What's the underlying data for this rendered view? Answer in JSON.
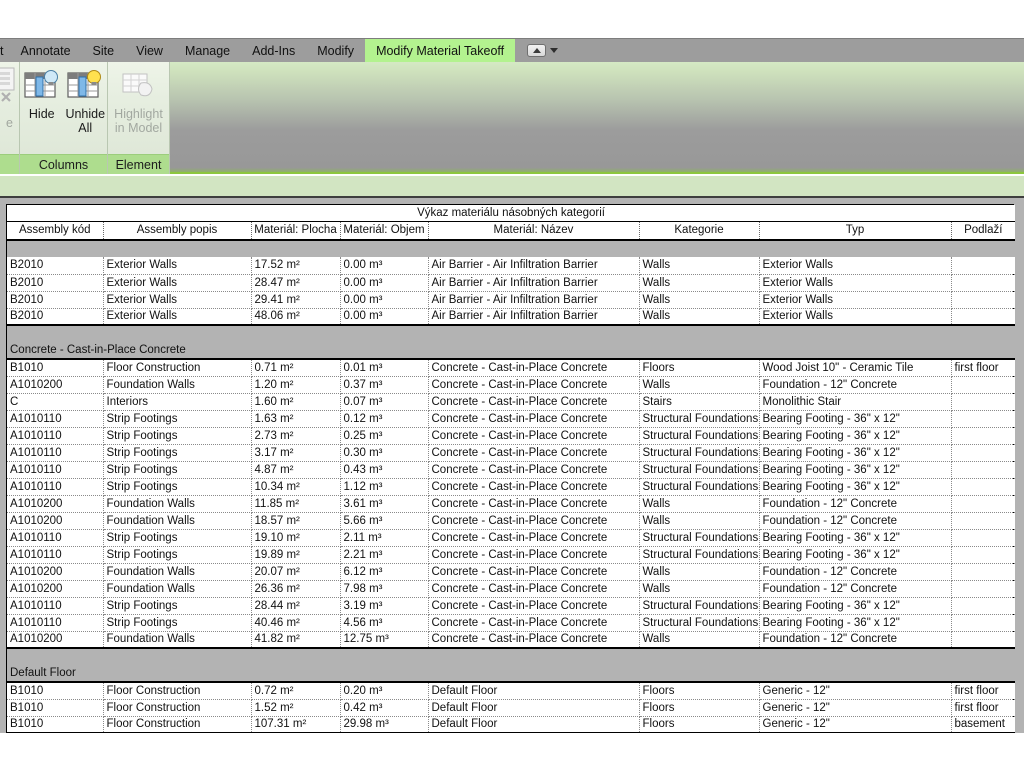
{
  "app": {
    "ribbon_tabs": [
      {
        "label": "t",
        "partial": true,
        "active": false
      },
      {
        "label": "Annotate",
        "partial": false,
        "active": false
      },
      {
        "label": "Site",
        "partial": false,
        "active": false
      },
      {
        "label": "View",
        "partial": false,
        "active": false
      },
      {
        "label": "Manage",
        "partial": false,
        "active": false
      },
      {
        "label": "Add-Ins",
        "partial": false,
        "active": false
      },
      {
        "label": "Modify",
        "partial": false,
        "active": false
      },
      {
        "label": "Modify Material Takeoff",
        "partial": false,
        "active": true
      }
    ],
    "accent_green": "#8cc63e",
    "active_tab_bg": "#b3f28f",
    "tabstrip_bg": "#9d9d9d"
  },
  "ribbon": {
    "panels": [
      {
        "title": "",
        "clipped": true,
        "buttons": [
          {
            "label": "e",
            "disabled": true,
            "icon": "paste-icon"
          }
        ]
      },
      {
        "title": "Columns",
        "clipped": false,
        "buttons": [
          {
            "label": "Hide",
            "disabled": false,
            "icon": "hide-columns-icon"
          },
          {
            "label": "Unhide All",
            "disabled": false,
            "icon": "unhide-all-columns-icon"
          }
        ]
      },
      {
        "title": "Element",
        "clipped": false,
        "buttons": [
          {
            "label": "Highlight in Model",
            "disabled": true,
            "icon": "highlight-in-model-icon"
          }
        ]
      }
    ]
  },
  "schedule": {
    "title": "Výkaz materiálu násobných kategorií",
    "columns": [
      "Assembly kód",
      "Assembly popis",
      "Materiál: Plocha",
      "Materiál: Objem",
      "Materiál: Název",
      "Kategorie",
      "Typ",
      "Podlaží"
    ],
    "groups": [
      {
        "header": null,
        "rows": [
          [
            "B2010",
            "Exterior Walls",
            "17.52 m²",
            "0.00 m³",
            "Air Barrier - Air Infiltration Barrier",
            "Walls",
            "Exterior Walls",
            ""
          ],
          [
            "B2010",
            "Exterior Walls",
            "28.47 m²",
            "0.00 m³",
            "Air Barrier - Air Infiltration Barrier",
            "Walls",
            "Exterior Walls",
            ""
          ],
          [
            "B2010",
            "Exterior Walls",
            "29.41 m²",
            "0.00 m³",
            "Air Barrier - Air Infiltration Barrier",
            "Walls",
            "Exterior Walls",
            ""
          ],
          [
            "B2010",
            "Exterior Walls",
            "48.06 m²",
            "0.00 m³",
            "Air Barrier - Air Infiltration Barrier",
            "Walls",
            "Exterior Walls",
            ""
          ]
        ]
      },
      {
        "header": "Concrete - Cast-in-Place Concrete",
        "rows": [
          [
            "B1010",
            "Floor Construction",
            "0.71 m²",
            "0.01 m³",
            "Concrete - Cast-in-Place Concrete",
            "Floors",
            "Wood Joist 10\" - Ceramic Tile",
            "first floor"
          ],
          [
            "A1010200",
            "Foundation Walls",
            "1.20 m²",
            "0.37 m³",
            "Concrete - Cast-in-Place Concrete",
            "Walls",
            "Foundation - 12\" Concrete",
            ""
          ],
          [
            "C",
            "Interiors",
            "1.60 m²",
            "0.07 m³",
            "Concrete - Cast-in-Place Concrete",
            "Stairs",
            "Monolithic Stair",
            ""
          ],
          [
            "A1010110",
            "Strip Footings",
            "1.63 m²",
            "0.12 m³",
            "Concrete - Cast-in-Place Concrete",
            "Structural Foundations",
            "Bearing Footing - 36\" x 12\"",
            ""
          ],
          [
            "A1010110",
            "Strip Footings",
            "2.73 m²",
            "0.25 m³",
            "Concrete - Cast-in-Place Concrete",
            "Structural Foundations",
            "Bearing Footing - 36\" x 12\"",
            ""
          ],
          [
            "A1010110",
            "Strip Footings",
            "3.17 m²",
            "0.30 m³",
            "Concrete - Cast-in-Place Concrete",
            "Structural Foundations",
            "Bearing Footing - 36\" x 12\"",
            ""
          ],
          [
            "A1010110",
            "Strip Footings",
            "4.87 m²",
            "0.43 m³",
            "Concrete - Cast-in-Place Concrete",
            "Structural Foundations",
            "Bearing Footing - 36\" x 12\"",
            ""
          ],
          [
            "A1010110",
            "Strip Footings",
            "10.34 m²",
            "1.12 m³",
            "Concrete - Cast-in-Place Concrete",
            "Structural Foundations",
            "Bearing Footing - 36\" x 12\"",
            ""
          ],
          [
            "A1010200",
            "Foundation Walls",
            "11.85 m²",
            "3.61 m³",
            "Concrete - Cast-in-Place Concrete",
            "Walls",
            "Foundation - 12\" Concrete",
            ""
          ],
          [
            "A1010200",
            "Foundation Walls",
            "18.57 m²",
            "5.66 m³",
            "Concrete - Cast-in-Place Concrete",
            "Walls",
            "Foundation - 12\" Concrete",
            ""
          ],
          [
            "A1010110",
            "Strip Footings",
            "19.10 m²",
            "2.11 m³",
            "Concrete - Cast-in-Place Concrete",
            "Structural Foundations",
            "Bearing Footing - 36\" x 12\"",
            ""
          ],
          [
            "A1010110",
            "Strip Footings",
            "19.89 m²",
            "2.21 m³",
            "Concrete - Cast-in-Place Concrete",
            "Structural Foundations",
            "Bearing Footing - 36\" x 12\"",
            ""
          ],
          [
            "A1010200",
            "Foundation Walls",
            "20.07 m²",
            "6.12 m³",
            "Concrete - Cast-in-Place Concrete",
            "Walls",
            "Foundation - 12\" Concrete",
            ""
          ],
          [
            "A1010200",
            "Foundation Walls",
            "26.36 m²",
            "7.98 m³",
            "Concrete - Cast-in-Place Concrete",
            "Walls",
            "Foundation - 12\" Concrete",
            ""
          ],
          [
            "A1010110",
            "Strip Footings",
            "28.44 m²",
            "3.19 m³",
            "Concrete - Cast-in-Place Concrete",
            "Structural Foundations",
            "Bearing Footing - 36\" x 12\"",
            ""
          ],
          [
            "A1010110",
            "Strip Footings",
            "40.46 m²",
            "4.56 m³",
            "Concrete - Cast-in-Place Concrete",
            "Structural Foundations",
            "Bearing Footing - 36\" x 12\"",
            ""
          ],
          [
            "A1010200",
            "Foundation Walls",
            "41.82 m²",
            "12.75 m³",
            "Concrete - Cast-in-Place Concrete",
            "Walls",
            "Foundation - 12\" Concrete",
            ""
          ]
        ]
      },
      {
        "header": "Default Floor",
        "rows": [
          [
            "B1010",
            "Floor Construction",
            "0.72 m²",
            "0.20 m³",
            "Default Floor",
            "Floors",
            "Generic - 12\"",
            "first floor"
          ],
          [
            "B1010",
            "Floor Construction",
            "1.52 m²",
            "0.42 m³",
            "Default Floor",
            "Floors",
            "Generic - 12\"",
            "first floor"
          ],
          [
            "B1010",
            "Floor Construction",
            "107.31 m²",
            "29.98 m³",
            "Default Floor",
            "Floors",
            "Generic - 12\"",
            "basement"
          ]
        ]
      }
    ]
  }
}
